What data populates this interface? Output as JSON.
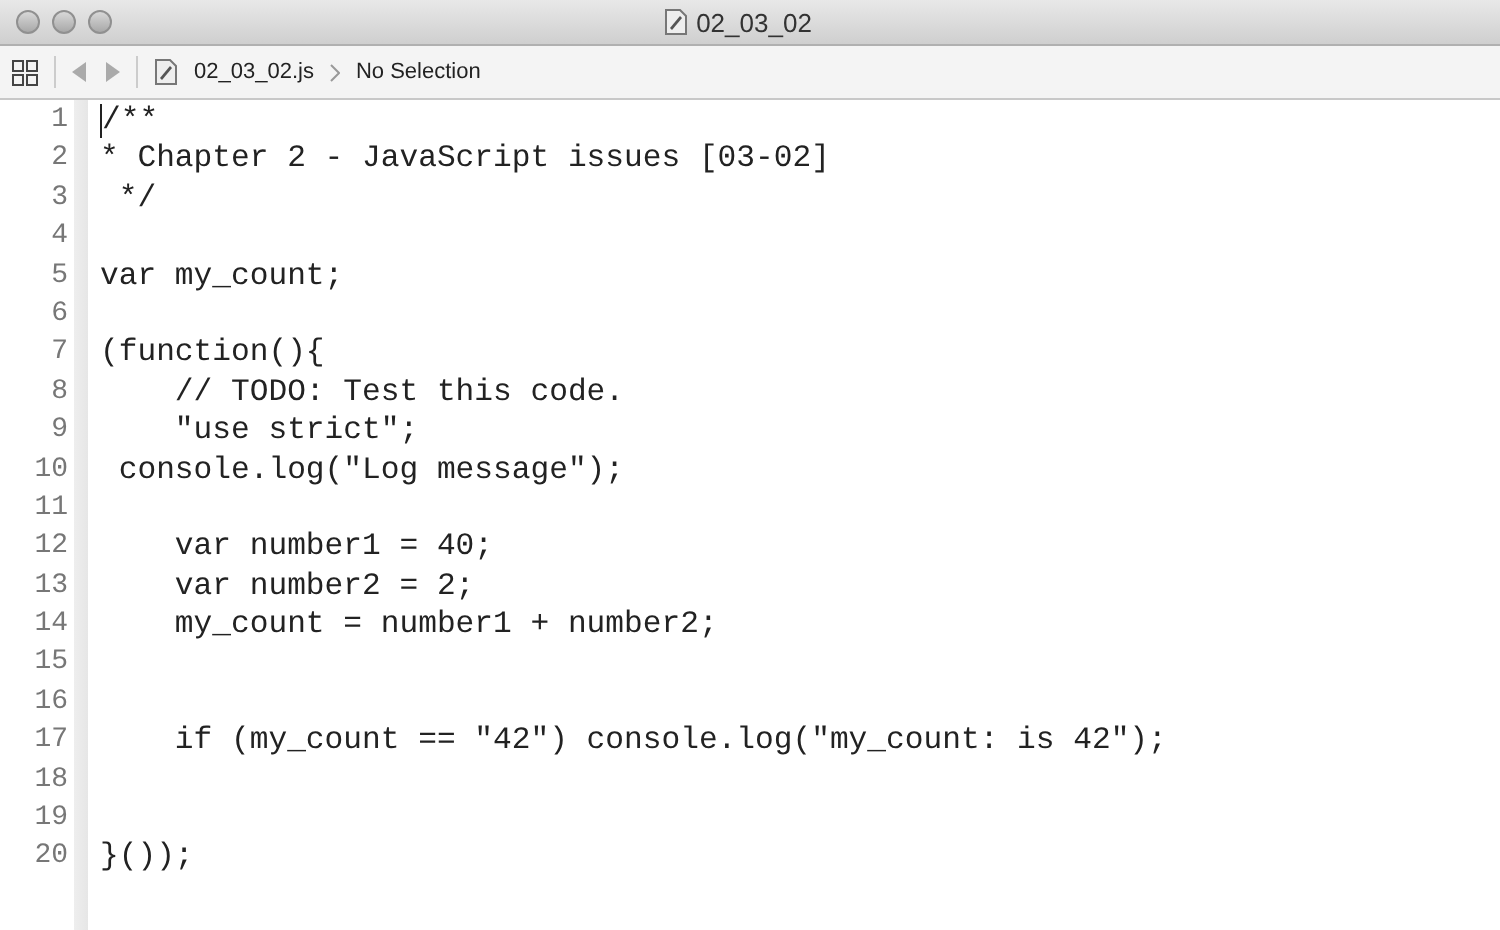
{
  "window": {
    "title": "02_03_02"
  },
  "toolbar": {
    "file": "02_03_02.js",
    "selection": "No Selection"
  },
  "lines": [
    {
      "number": "1",
      "text": "/**",
      "cursor": true
    },
    {
      "number": "2",
      "text": "* Chapter 2 - JavaScript issues [03-02]"
    },
    {
      "number": "3",
      "text": " */"
    },
    {
      "number": "4"
    },
    {
      "number": "5",
      "text": "var my_count;"
    },
    {
      "number": "6"
    },
    {
      "number": "7",
      "text": "(function(){"
    },
    {
      "number": "8",
      "text": "    // TODO: Test this code."
    },
    {
      "number": "9",
      "text": "    \"use strict\";"
    },
    {
      "number": "10",
      "text": " console.log(\"Log message\");"
    },
    {
      "number": "11"
    },
    {
      "number": "12",
      "text": "    var number1 = 40;"
    },
    {
      "number": "13",
      "text": "    var number2 = 2;"
    },
    {
      "number": "14",
      "text": "    my_count = number1 + number2;"
    },
    {
      "number": "15"
    },
    {
      "number": "16"
    },
    {
      "number": "17",
      "text": "    if (my_count == \"42\") console.log(\"my_count: is 42\");"
    },
    {
      "number": "18"
    },
    {
      "number": "19"
    },
    {
      "number": "20",
      "text": "}());"
    }
  ]
}
